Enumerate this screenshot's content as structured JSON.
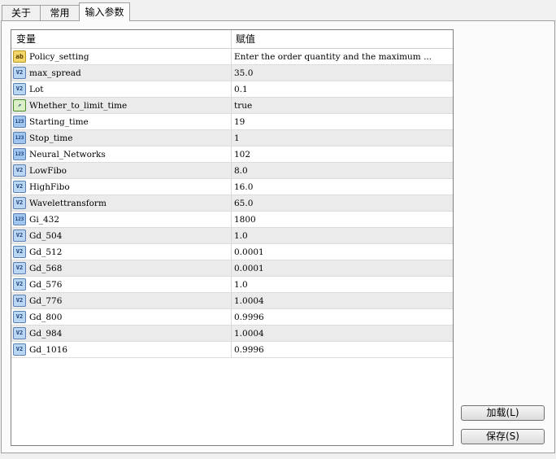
{
  "tabs": [
    {
      "label": "关于",
      "active": false
    },
    {
      "label": "常用",
      "active": false
    },
    {
      "label": "输入参数",
      "active": true
    }
  ],
  "table": {
    "columns": [
      "变量",
      "赋值"
    ],
    "rows": [
      {
        "icon": "ab",
        "name": "Policy_setting",
        "value": "Enter the order quantity and the maximum ..."
      },
      {
        "icon": "v2",
        "name": "max_spread",
        "value": "35.0"
      },
      {
        "icon": "v2",
        "name": "Lot",
        "value": "0.1"
      },
      {
        "icon": "bool",
        "name": "Whether_to_limit_time",
        "value": "true"
      },
      {
        "icon": "123",
        "name": "Starting_time",
        "value": "19"
      },
      {
        "icon": "123",
        "name": "Stop_time",
        "value": "1"
      },
      {
        "icon": "123",
        "name": "Neural_Networks",
        "value": "102"
      },
      {
        "icon": "v2",
        "name": "LowFibo",
        "value": "8.0"
      },
      {
        "icon": "v2",
        "name": "HighFibo",
        "value": "16.0"
      },
      {
        "icon": "v2",
        "name": "Wavelettransform",
        "value": "65.0"
      },
      {
        "icon": "123",
        "name": "Gi_432",
        "value": "1800"
      },
      {
        "icon": "v2",
        "name": "Gd_504",
        "value": "1.0"
      },
      {
        "icon": "v2",
        "name": "Gd_512",
        "value": "0.0001"
      },
      {
        "icon": "v2",
        "name": "Gd_568",
        "value": "0.0001"
      },
      {
        "icon": "v2",
        "name": "Gd_576",
        "value": "1.0"
      },
      {
        "icon": "v2",
        "name": "Gd_776",
        "value": "1.0004"
      },
      {
        "icon": "v2",
        "name": "Gd_800",
        "value": "0.9996"
      },
      {
        "icon": "v2",
        "name": "Gd_984",
        "value": "1.0004"
      },
      {
        "icon": "v2",
        "name": "Gd_1016",
        "value": "0.9996"
      }
    ]
  },
  "buttons": {
    "load": "加载(L)",
    "save": "保存(S)"
  },
  "icon_glyphs": {
    "ab": "ab",
    "v2": "V2",
    "123": "123",
    "bool": "↗"
  }
}
